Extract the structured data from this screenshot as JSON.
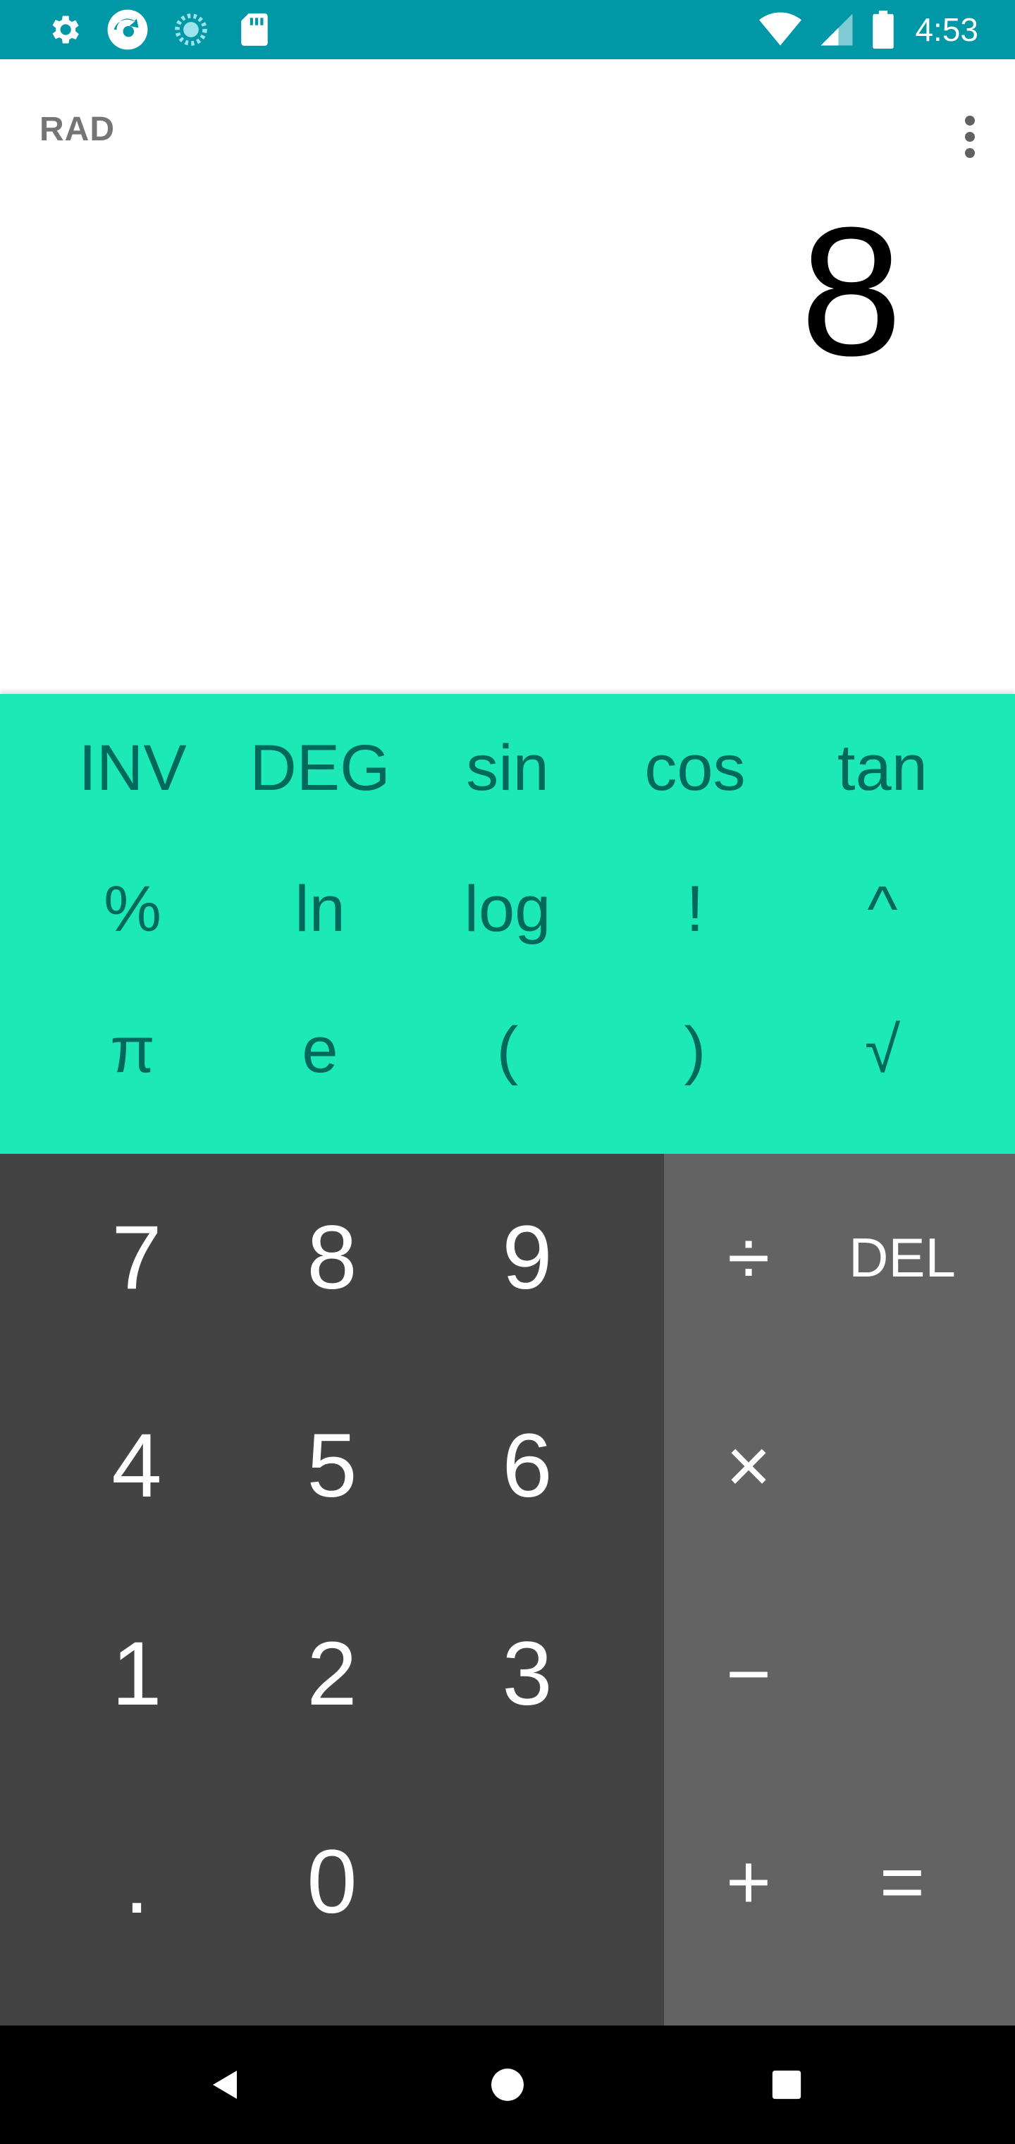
{
  "status_bar": {
    "time": "4:53",
    "left_icons": [
      "settings-icon",
      "app-logo-icon",
      "loading-icon",
      "sd-card-icon"
    ],
    "right_icons": [
      "wifi-icon",
      "cell-signal-icon",
      "battery-icon"
    ],
    "background": "#0097A7"
  },
  "display": {
    "angle_mode": "RAD",
    "result": "8"
  },
  "advanced_pad": {
    "background": "#1DE9B6",
    "rows": [
      [
        "INV",
        "DEG",
        "sin",
        "cos",
        "tan"
      ],
      [
        "%",
        "ln",
        "log",
        "!",
        "^"
      ],
      [
        "π",
        "e",
        "(",
        ")",
        "√"
      ]
    ]
  },
  "numeric_pad": {
    "background": "#434343",
    "rows": [
      [
        "7",
        "8",
        "9"
      ],
      [
        "4",
        "5",
        "6"
      ],
      [
        "1",
        "2",
        "3"
      ],
      [
        ".",
        "0"
      ]
    ]
  },
  "operator_pad": {
    "background": "#636363",
    "divide": "÷",
    "delete": "DEL",
    "multiply": "×",
    "minus": "−",
    "plus": "+",
    "equals": "="
  },
  "nav_bar": {
    "buttons": [
      "back-icon",
      "home-icon",
      "recents-icon"
    ]
  }
}
